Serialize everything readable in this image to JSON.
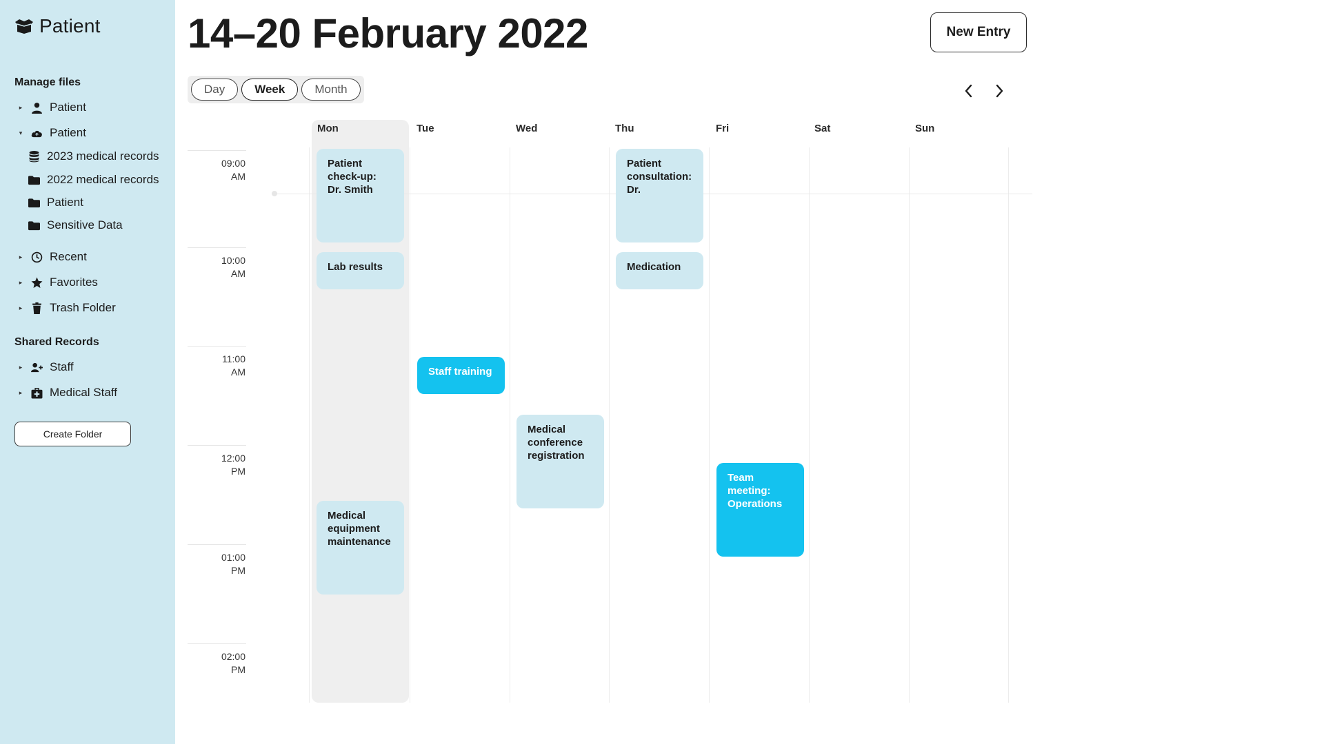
{
  "sidebar": {
    "brand": "Patient",
    "manage_label": "Manage files",
    "items": [
      {
        "label": "Patient",
        "icon": "user-icon",
        "chevron": "right"
      },
      {
        "label": "Patient",
        "icon": "cloud-icon",
        "chevron": "down"
      },
      {
        "label": "2023 medical records",
        "icon": "database-icon"
      },
      {
        "label": "2022 medical records",
        "icon": "folder-icon"
      },
      {
        "label": "Patient",
        "icon": "folder-icon"
      },
      {
        "label": "Sensitive Data",
        "icon": "folder-icon"
      },
      {
        "label": "Recent",
        "icon": "clock-icon",
        "chevron": "right"
      },
      {
        "label": "Favorites",
        "icon": "star-icon",
        "chevron": "right"
      },
      {
        "label": "Trash Folder",
        "icon": "trash-icon",
        "chevron": "right"
      }
    ],
    "shared_label": "Shared Records",
    "shared_items": [
      {
        "label": "Staff",
        "icon": "user-plus-icon",
        "chevron": "right"
      },
      {
        "label": "Medical Staff",
        "icon": "medical-kit-icon",
        "chevron": "right"
      }
    ],
    "create_folder": "Create Folder"
  },
  "header": {
    "title": "14–20 February 2022",
    "new_entry": "New Entry",
    "views": [
      "Day",
      "Week",
      "Month"
    ],
    "active_view": "Week"
  },
  "calendar": {
    "days": [
      "Mon",
      "Tue",
      "Wed",
      "Thu",
      "Fri",
      "Sat",
      "Sun"
    ],
    "selected_day": "Mon",
    "times": [
      {
        "time": "09:00",
        "period": "AM"
      },
      {
        "time": "10:00",
        "period": "AM"
      },
      {
        "time": "11:00",
        "period": "AM"
      },
      {
        "time": "12:00",
        "period": "PM"
      },
      {
        "time": "01:00",
        "period": "PM"
      },
      {
        "time": "02:00",
        "period": "PM"
      }
    ],
    "events": [
      {
        "title": "Patient check-up: Dr. Smith",
        "day": "Mon",
        "start": "09:00",
        "end": "10:00"
      },
      {
        "title": "Lab results",
        "day": "Mon",
        "start": "10:00",
        "end": "10:30"
      },
      {
        "title": "Medical equipment maintenance",
        "day": "Mon",
        "start": "12:35",
        "end": "13:35"
      },
      {
        "title": "Staff training",
        "day": "Tue",
        "start": "11:05",
        "end": "11:35"
      },
      {
        "title": "Medical conference registration",
        "day": "Wed",
        "start": "11:40",
        "end": "12:40"
      },
      {
        "title": "Patient consultation: Dr.",
        "day": "Thu",
        "start": "09:00",
        "end": "10:00"
      },
      {
        "title": "Medication",
        "day": "Thu",
        "start": "10:00",
        "end": "10:30"
      },
      {
        "title": "Team meeting: Operations",
        "day": "Fri",
        "start": "12:10",
        "end": "13:10"
      }
    ]
  },
  "colors": {
    "sidebar_bg": "#cfe9f1",
    "event_light": "#cfe9f1",
    "event_accent": "#14c2ef"
  }
}
